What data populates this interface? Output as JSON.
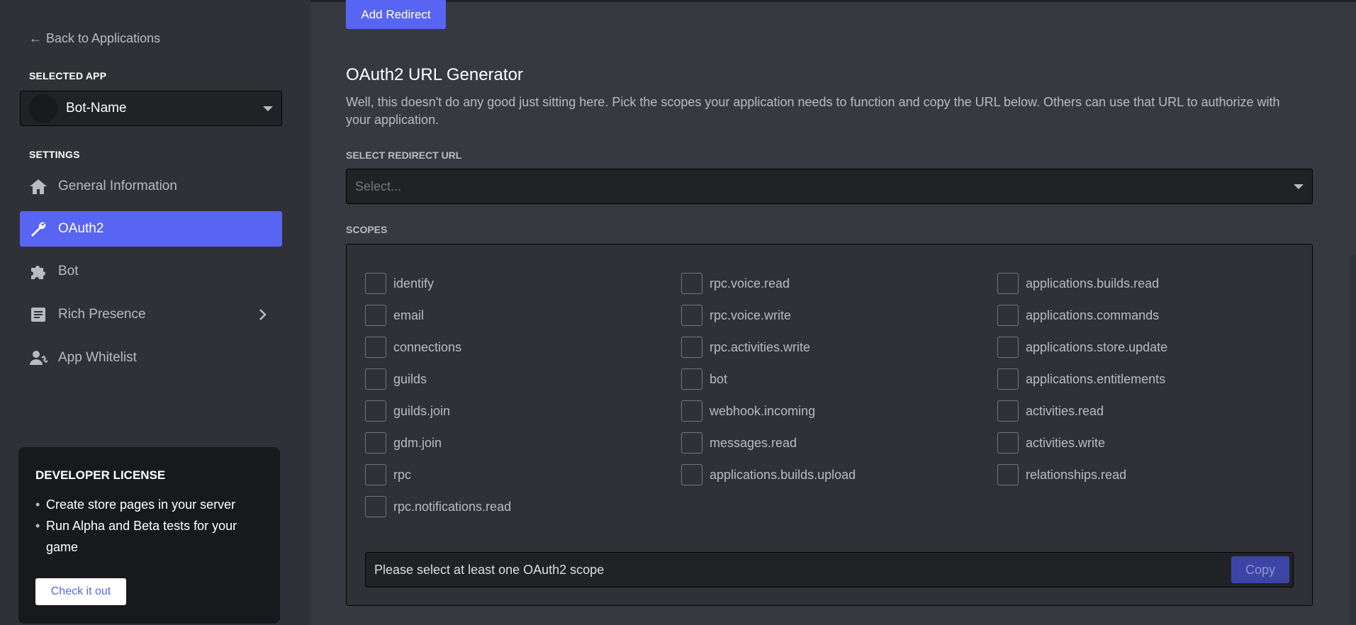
{
  "sidebar": {
    "back_label": "Back to Applications",
    "selected_app_label": "SELECTED APP",
    "app_name": "Bot-Name",
    "settings_label": "SETTINGS",
    "items": [
      {
        "label": "General Information",
        "icon": "home-icon"
      },
      {
        "label": "OAuth2",
        "icon": "wrench-icon",
        "active": true
      },
      {
        "label": "Bot",
        "icon": "puzzle-icon"
      },
      {
        "label": "Rich Presence",
        "icon": "document-icon",
        "has_chevron": true
      },
      {
        "label": "App Whitelist",
        "icon": "user-phone-icon"
      }
    ],
    "license": {
      "title": "DEVELOPER LICENSE",
      "items": [
        "Create store pages in your server",
        "Run Alpha and Beta tests for your game"
      ],
      "button": "Check it out"
    }
  },
  "main": {
    "add_redirect": "Add Redirect",
    "title": "OAuth2 URL Generator",
    "description": "Well, this doesn't do any good just sitting here. Pick the scopes your application needs to function and copy the URL below. Others can use that URL to authorize with your application.",
    "redirect_label": "SELECT REDIRECT URL",
    "redirect_placeholder": "Select...",
    "scopes_label": "SCOPES",
    "scopes": {
      "col1": [
        "identify",
        "email",
        "connections",
        "guilds",
        "guilds.join",
        "gdm.join",
        "rpc",
        "rpc.notifications.read"
      ],
      "col2": [
        "rpc.voice.read",
        "rpc.voice.write",
        "rpc.activities.write",
        "bot",
        "webhook.incoming",
        "messages.read",
        "applications.builds.upload"
      ],
      "col3": [
        "applications.builds.read",
        "applications.commands",
        "applications.store.update",
        "applications.entitlements",
        "activities.read",
        "activities.write",
        "relationships.read"
      ]
    },
    "url_text": "Please select at least one OAuth2 scope",
    "copy_label": "Copy"
  },
  "colors": {
    "accent": "#5865f2",
    "background": "#36393f",
    "sidebar": "#2f3136"
  }
}
